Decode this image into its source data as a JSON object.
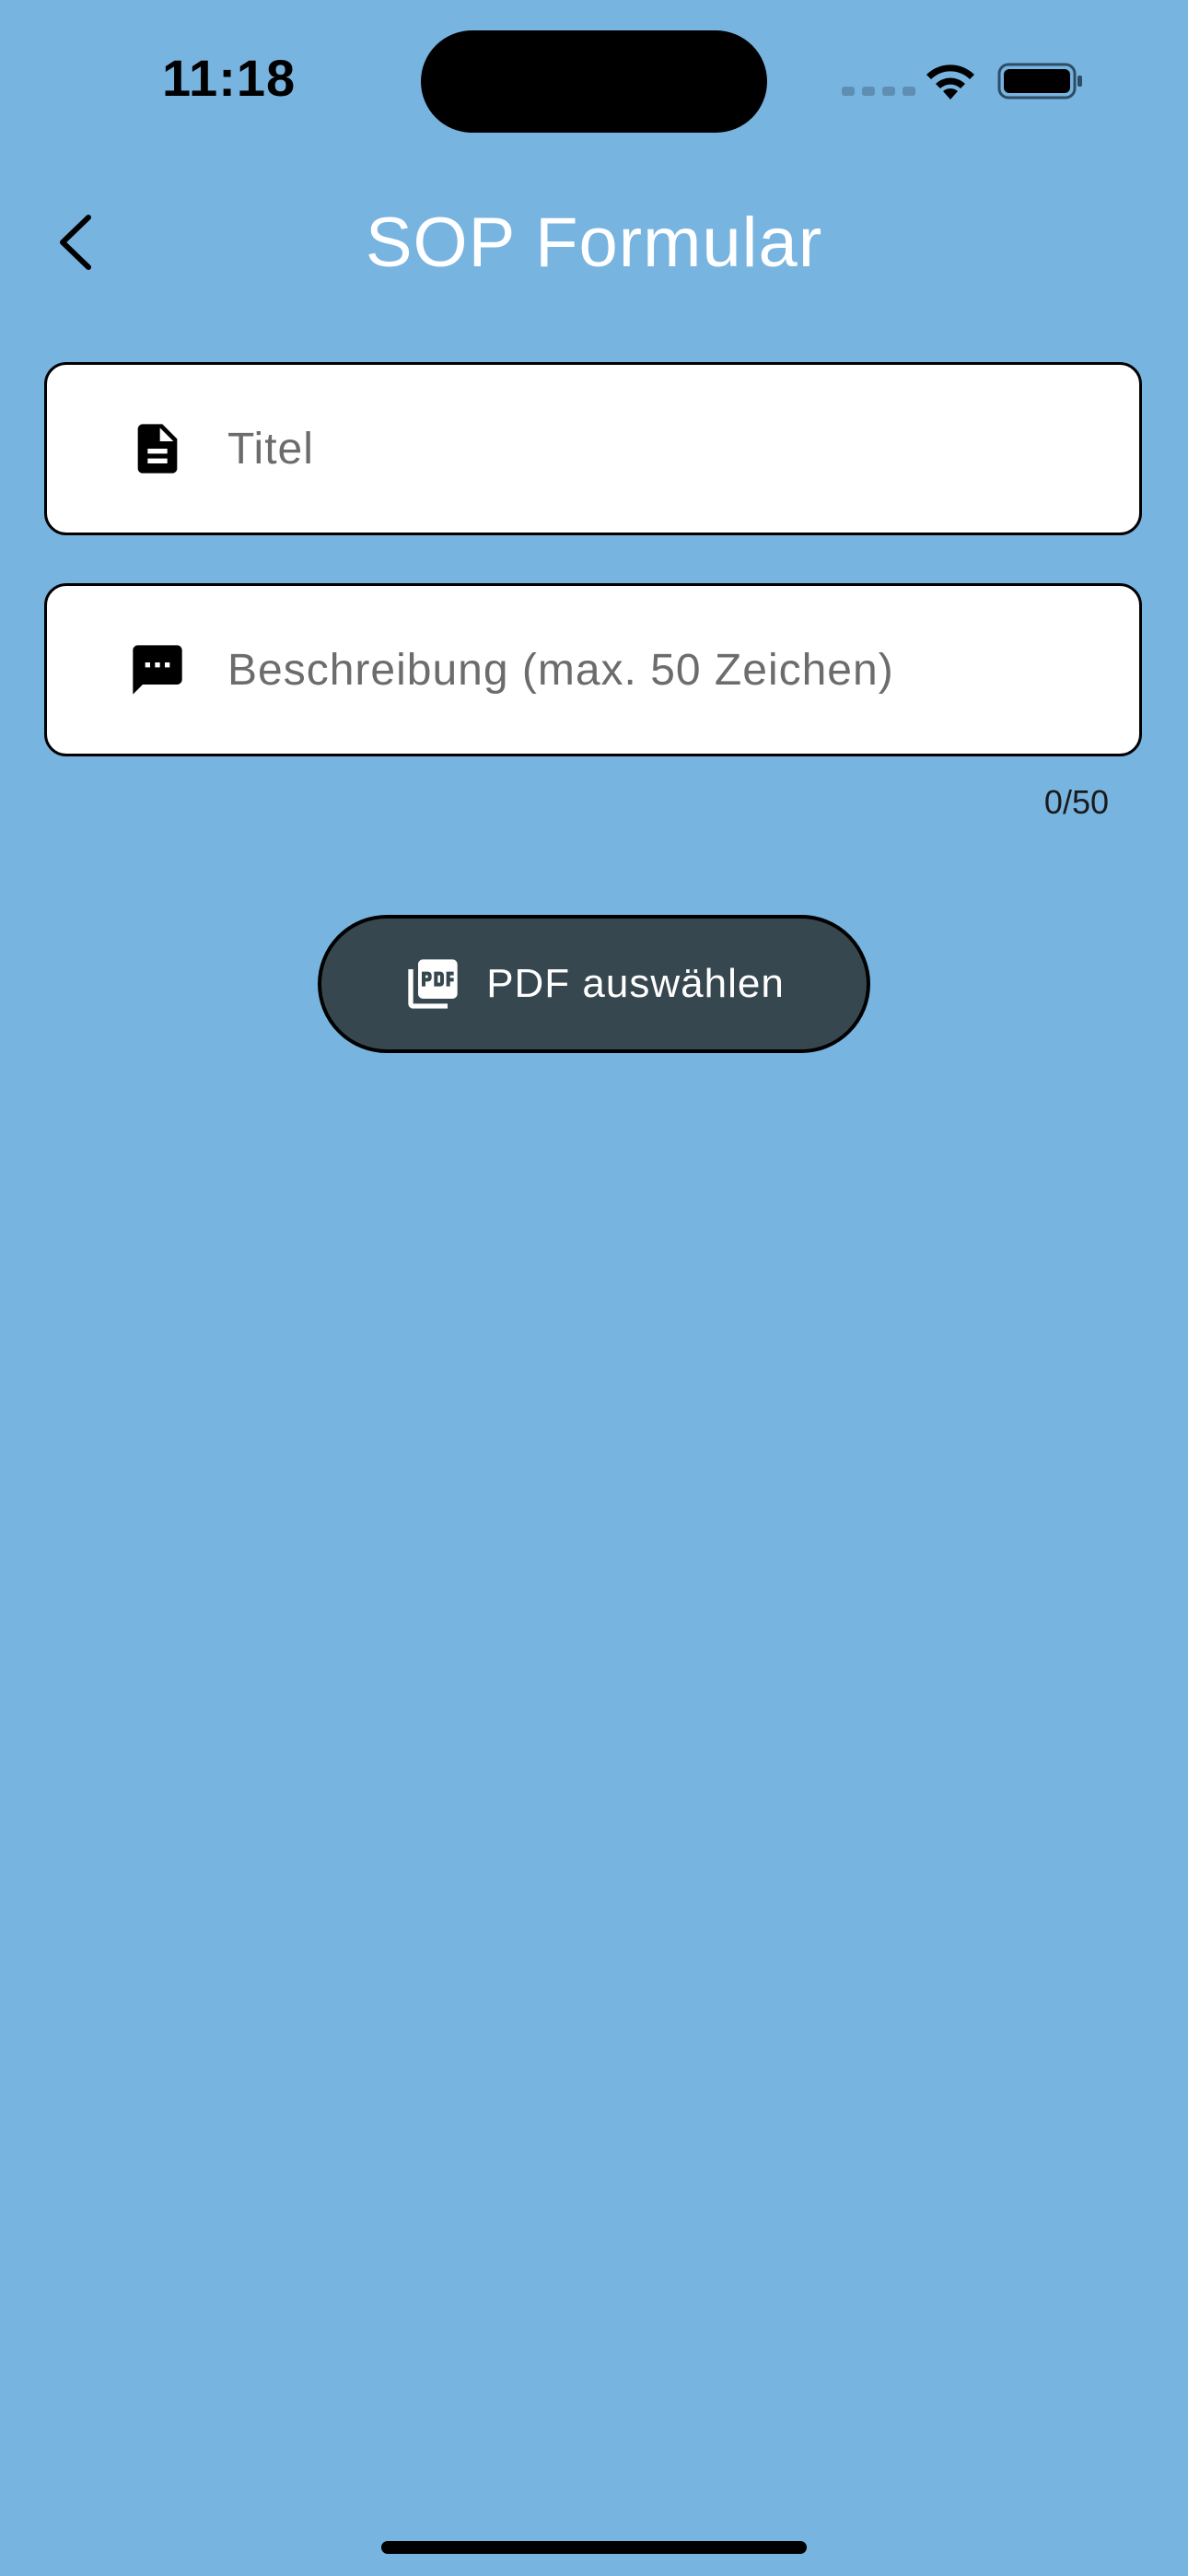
{
  "status_bar": {
    "time": "11:18"
  },
  "nav": {
    "title": "SOP Formular",
    "back_icon": "chevron-left-icon"
  },
  "form": {
    "title_field": {
      "placeholder": "Titel",
      "value": "",
      "icon": "document-icon"
    },
    "description_field": {
      "placeholder": "Beschreibung (max. 50 Zeichen)",
      "value": "",
      "icon": "chat-bubble-icon",
      "counter": "0/50"
    },
    "pdf_button": {
      "label": "PDF auswählen",
      "icon": "pdf-icon"
    }
  },
  "colors": {
    "background": "#78b4e0",
    "button": "#37474f",
    "title_text": "#ffffff"
  }
}
